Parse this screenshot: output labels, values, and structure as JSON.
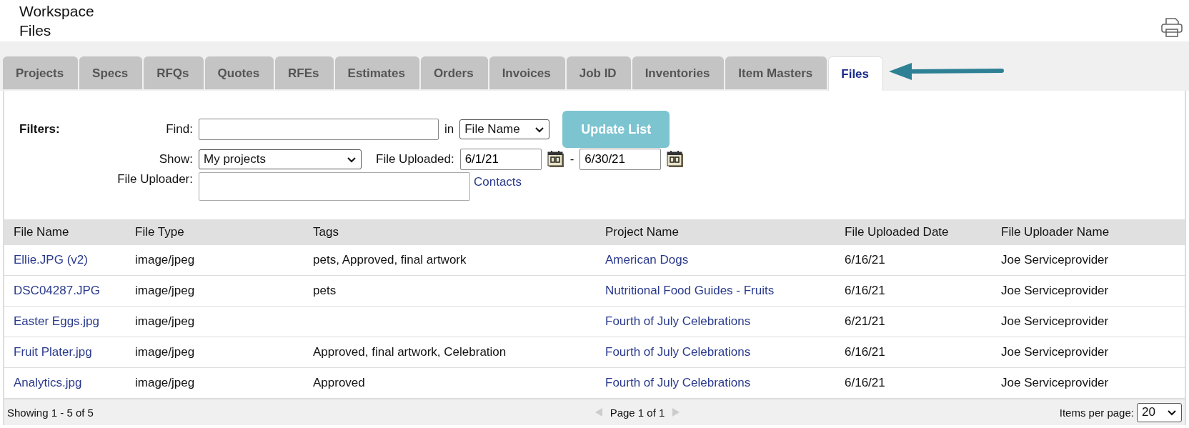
{
  "header": {
    "section": "Workspace",
    "page": "Files"
  },
  "tabs": [
    {
      "label": "Projects",
      "selected": false
    },
    {
      "label": "Specs",
      "selected": false
    },
    {
      "label": "RFQs",
      "selected": false
    },
    {
      "label": "Quotes",
      "selected": false
    },
    {
      "label": "RFEs",
      "selected": false
    },
    {
      "label": "Estimates",
      "selected": false
    },
    {
      "label": "Orders",
      "selected": false
    },
    {
      "label": "Invoices",
      "selected": false
    },
    {
      "label": "Job ID",
      "selected": false
    },
    {
      "label": "Inventories",
      "selected": false
    },
    {
      "label": "Item Masters",
      "selected": false
    },
    {
      "label": "Files",
      "selected": true
    }
  ],
  "filters": {
    "heading": "Filters:",
    "find": {
      "label": "Find:",
      "in_label": "in",
      "scope": "File Name"
    },
    "update_button": {
      "label": "Update List",
      "disabled": true
    },
    "show": {
      "label": "Show:",
      "value": "My projects"
    },
    "file_uploaded": {
      "label": "File Uploaded:",
      "from": "6/1/21",
      "separator": "-",
      "to": "6/30/21"
    },
    "file_uploader": {
      "label": "File Uploader:",
      "link": "Contacts"
    }
  },
  "table": {
    "columns": [
      {
        "label": "File Name",
        "link": true
      },
      {
        "label": "File Type",
        "link": false
      },
      {
        "label": "Tags",
        "link": false
      },
      {
        "label": "Project Name",
        "link": true
      },
      {
        "label": "File Uploaded Date",
        "link": false
      },
      {
        "label": "File Uploader Name",
        "link": false
      }
    ],
    "rows": [
      [
        "Ellie.JPG (v2)",
        "image/jpeg",
        "pets, Approved, final artwork",
        "American Dogs",
        "6/16/21",
        "Joe Serviceprovider"
      ],
      [
        "DSC04287.JPG",
        "image/jpeg",
        "pets",
        "Nutritional Food Guides - Fruits",
        "6/16/21",
        "Joe Serviceprovider"
      ],
      [
        "Easter Eggs.jpg",
        "image/jpeg",
        "",
        "Fourth of July Celebrations",
        "6/21/21",
        "Joe Serviceprovider"
      ],
      [
        "Fruit Plater.jpg",
        "image/jpeg",
        "Approved, final artwork, Celebration",
        "Fourth of July Celebrations",
        "6/16/21",
        "Joe Serviceprovider"
      ],
      [
        "Analytics.jpg",
        "image/jpeg",
        "Approved",
        "Fourth of July Celebrations",
        "6/16/21",
        "Joe Serviceprovider"
      ]
    ]
  },
  "footer": {
    "showing": "Showing 1 - 5 of 5",
    "page": "Page 1 of 1",
    "prev_disabled": true,
    "next_disabled": true,
    "items_label": "Items per page:",
    "items_value": "20"
  }
}
